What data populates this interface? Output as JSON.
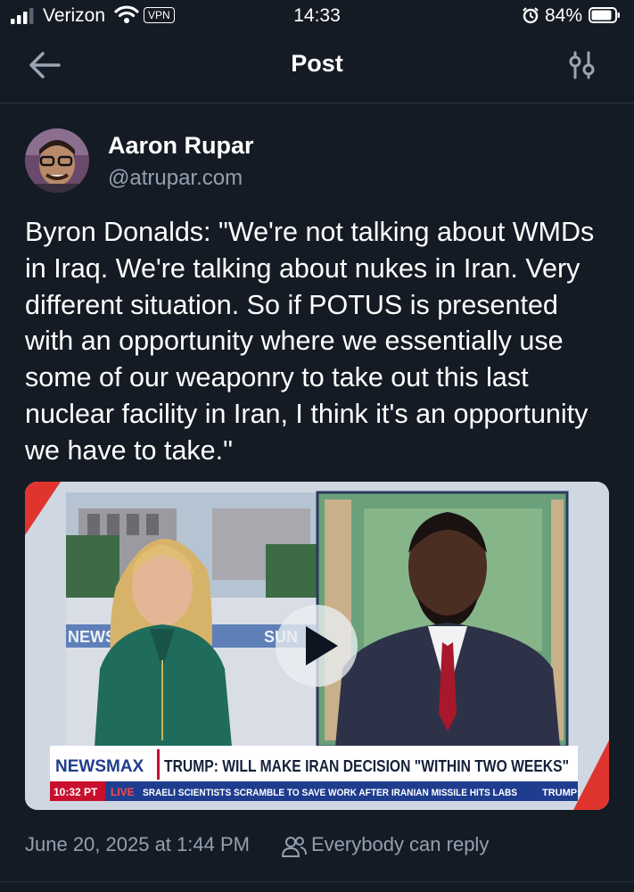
{
  "status_bar": {
    "carrier": "Verizon",
    "vpn": "VPN",
    "time": "14:33",
    "battery": "84%"
  },
  "nav": {
    "title": "Post",
    "back_icon": "arrow-left-icon",
    "settings_icon": "sliders-icon"
  },
  "post": {
    "author_name": "Aaron Rupar",
    "handle": "@atrupar.com",
    "text": "Byron Donalds: \"We're not talking about WMDs in Iraq. We're talking about nukes in Iran. Very different situation. So if POTUS is presented with an opportunity where we essentially use some of our weaponry to take out this last nuclear facility in Iran, I think it's an opportunity we have to take.\"",
    "timestamp": "June 20, 2025 at 1:44 PM",
    "reply_setting": "Everybody can reply"
  },
  "video": {
    "brand": "NEWSMAX",
    "headline": "TRUMP: WILL MAKE IRAN DECISION \"WITHIN TWO WEEKS\"",
    "clock": "10:32 PT",
    "live": "LIVE",
    "ticker": "SRAELI SCIENTISTS SCRAMBLE TO SAVE WORK AFTER IRANIAN MISSILE HITS LABS",
    "ticker_tail": "TRUMP: ",
    "wall_text_left": "NEWS",
    "wall_text_right": "SUN"
  },
  "colors": {
    "background": "#151b24",
    "secondary_text": "#93a0b0",
    "newsmax_blue": "#1f3d8f",
    "live_red": "#c8102e"
  }
}
